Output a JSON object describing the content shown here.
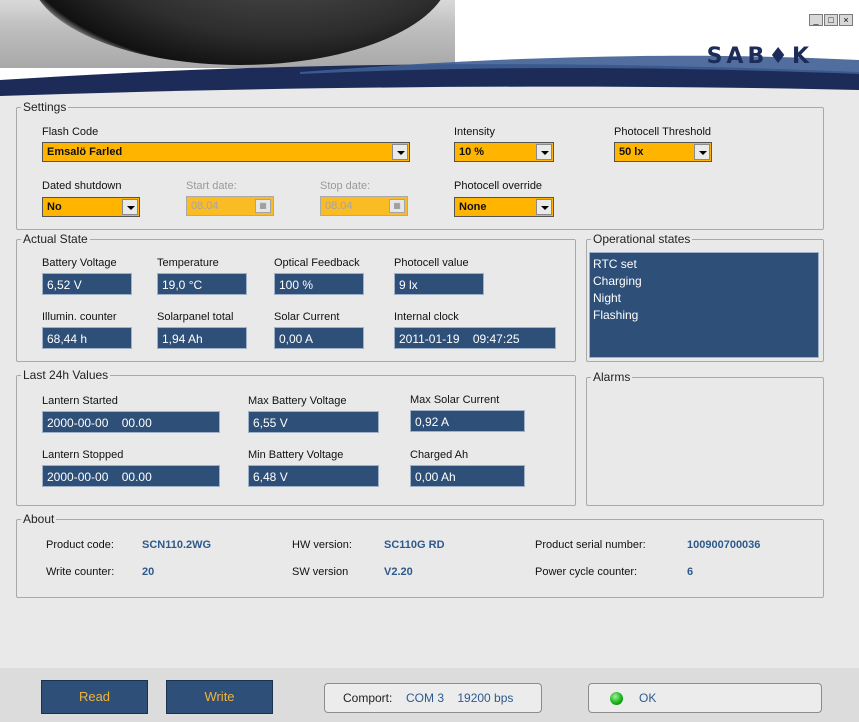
{
  "window": {
    "controls": [
      "_",
      "□",
      "×"
    ]
  },
  "brand": {
    "logo_text": "SAB♦K"
  },
  "settings": {
    "legend": "Settings",
    "flash_code": {
      "label": "Flash Code",
      "value": "Emsalö Farled"
    },
    "intensity": {
      "label": "Intensity",
      "value": "10 %"
    },
    "photocell_threshold": {
      "label": "Photocell Threshold",
      "value": "50 lx"
    },
    "dated_shutdown": {
      "label": "Dated shutdown",
      "value": "No"
    },
    "start_date": {
      "label": "Start date:",
      "value": "08.04"
    },
    "stop_date": {
      "label": "Stop date:",
      "value": "08.04"
    },
    "photocell_override": {
      "label": "Photocell override",
      "value": "None"
    }
  },
  "actual_state": {
    "legend": "Actual State",
    "items": [
      {
        "label": "Battery Voltage",
        "value": "6,52 V"
      },
      {
        "label": "Temperature",
        "value": "19,0 °C"
      },
      {
        "label": "Optical Feedback",
        "value": "100 %"
      },
      {
        "label": "Photocell value",
        "value": "9 lx"
      },
      {
        "label": "Illumin. counter",
        "value": "68,44 h"
      },
      {
        "label": "Solarpanel total",
        "value": "1,94 Ah"
      },
      {
        "label": "Solar Current",
        "value": "0,00 A"
      },
      {
        "label": "Internal clock",
        "value": "2011-01-19    09:47:25"
      }
    ]
  },
  "operational_states": {
    "legend": "Operational states",
    "items": [
      "RTC set",
      "Charging",
      "Night",
      "Flashing"
    ]
  },
  "last24h": {
    "legend": "Last 24h Values",
    "items": [
      {
        "label": "Lantern Started",
        "value": "2000-00-00    00.00"
      },
      {
        "label": "Max Battery Voltage",
        "value": "6,55 V"
      },
      {
        "label": "Max Solar Current",
        "value": "0,92 A"
      },
      {
        "label": "Lantern Stopped",
        "value": "2000-00-00    00.00"
      },
      {
        "label": "Min Battery Voltage",
        "value": "6,48 V"
      },
      {
        "label": "Charged Ah",
        "value": "0,00 Ah"
      }
    ]
  },
  "alarms": {
    "legend": "Alarms"
  },
  "about": {
    "legend": "About",
    "product_code": {
      "label": "Product code:",
      "value": "SCN110.2WG"
    },
    "hw_version": {
      "label": "HW version:",
      "value": "SC110G RD"
    },
    "serial": {
      "label": "Product serial number:",
      "value": "100900700036"
    },
    "write_counter": {
      "label": "Write counter:",
      "value": "20"
    },
    "sw_version": {
      "label": "SW version",
      "value": "V2.20"
    },
    "power_cycle": {
      "label": "Power cycle counter:",
      "value": "6"
    }
  },
  "footer": {
    "read_label": "Read",
    "write_label": "Write",
    "comport_label": "Comport:",
    "comport_value": "COM 3    19200 bps",
    "status_value": "OK"
  },
  "colors": {
    "accent_orange": "#ffb400",
    "value_blue": "#2e4f78",
    "brand_navy": "#1c2b57",
    "status_green": "#18b418"
  }
}
